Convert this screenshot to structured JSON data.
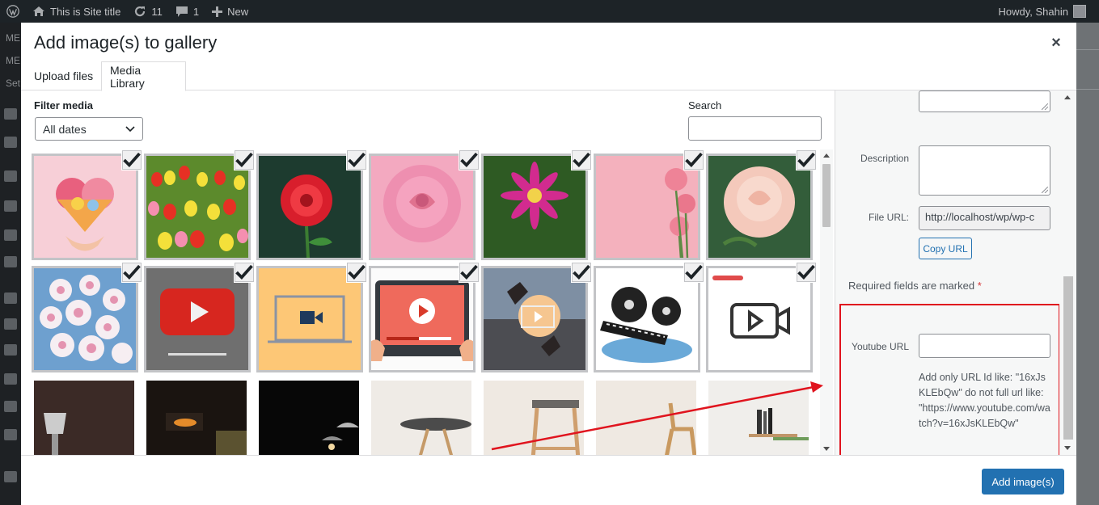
{
  "admin_bar": {
    "site_title": "This is Site title",
    "updates_count": "11",
    "comments_count": "1",
    "new_label": "New",
    "greeting": "Howdy, Shahin",
    "icons": [
      "wordpress-icon",
      "home-icon",
      "refresh-icon",
      "comment-icon",
      "plus-icon"
    ]
  },
  "admin_sidebar": {
    "visible_text": [
      "ME",
      "ME",
      "Set"
    ]
  },
  "modal": {
    "title": "Add image(s) to gallery",
    "close_symbol": "×",
    "tabs": [
      {
        "label": "Upload files",
        "active": false
      },
      {
        "label": "Media Library",
        "active": true
      }
    ],
    "filter": {
      "label": "Filter media",
      "selected": "All dates"
    },
    "search": {
      "label": "Search",
      "value": ""
    },
    "media_items": [
      {
        "name": "flowers-heart-hands",
        "selected": true,
        "icon": "image"
      },
      {
        "name": "tulip-field",
        "selected": true,
        "icon": "image"
      },
      {
        "name": "red-dahlia",
        "selected": true,
        "icon": "image"
      },
      {
        "name": "pink-rose",
        "selected": true,
        "icon": "image"
      },
      {
        "name": "pink-dahlia",
        "selected": true,
        "icon": "image"
      },
      {
        "name": "gerbera-on-pink",
        "selected": true,
        "icon": "image"
      },
      {
        "name": "peach-rose",
        "selected": true,
        "icon": "image"
      },
      {
        "name": "white-pink-daisies",
        "selected": true,
        "icon": "image"
      },
      {
        "name": "youtube-play-stone",
        "selected": true,
        "icon": "image"
      },
      {
        "name": "laptop-video-icon",
        "selected": true,
        "icon": "image"
      },
      {
        "name": "tablet-video-player",
        "selected": true,
        "icon": "image"
      },
      {
        "name": "hands-frame-sunset",
        "selected": true,
        "icon": "image"
      },
      {
        "name": "film-reel-clapper",
        "selected": true,
        "icon": "image"
      },
      {
        "name": "video-camera-icon",
        "selected": true,
        "icon": "image"
      },
      {
        "name": "lamp-interior",
        "selected": false,
        "icon": "image"
      },
      {
        "name": "fireplace-room",
        "selected": false,
        "icon": "image"
      },
      {
        "name": "pendant-lamp-dark",
        "selected": false,
        "icon": "image"
      },
      {
        "name": "round-table",
        "selected": false,
        "icon": "image"
      },
      {
        "name": "wooden-stool",
        "selected": false,
        "icon": "image"
      },
      {
        "name": "wooden-chair",
        "selected": false,
        "icon": "image"
      },
      {
        "name": "bookshelf-objects",
        "selected": false,
        "icon": "image"
      }
    ],
    "details": {
      "description_label": "Description",
      "file_url_label": "File URL:",
      "file_url_value": "http://localhost/wp/wp-c",
      "copy_url_label": "Copy URL",
      "required_text": "Required fields are marked",
      "required_star": "*",
      "youtube_label": "Youtube URL",
      "youtube_value": "",
      "youtube_help": "Add only URL Id like: \"16xJsKLEbQw\" do not full url like: \"https://www.youtube.com/watch?v=16xJsKLEbQw\""
    },
    "toolbar": {
      "add_button_label": "Add image(s)"
    }
  },
  "colors": {
    "accent": "#2271b1",
    "highlight_box": "#e0141e",
    "admin_bar": "#1d2327"
  }
}
